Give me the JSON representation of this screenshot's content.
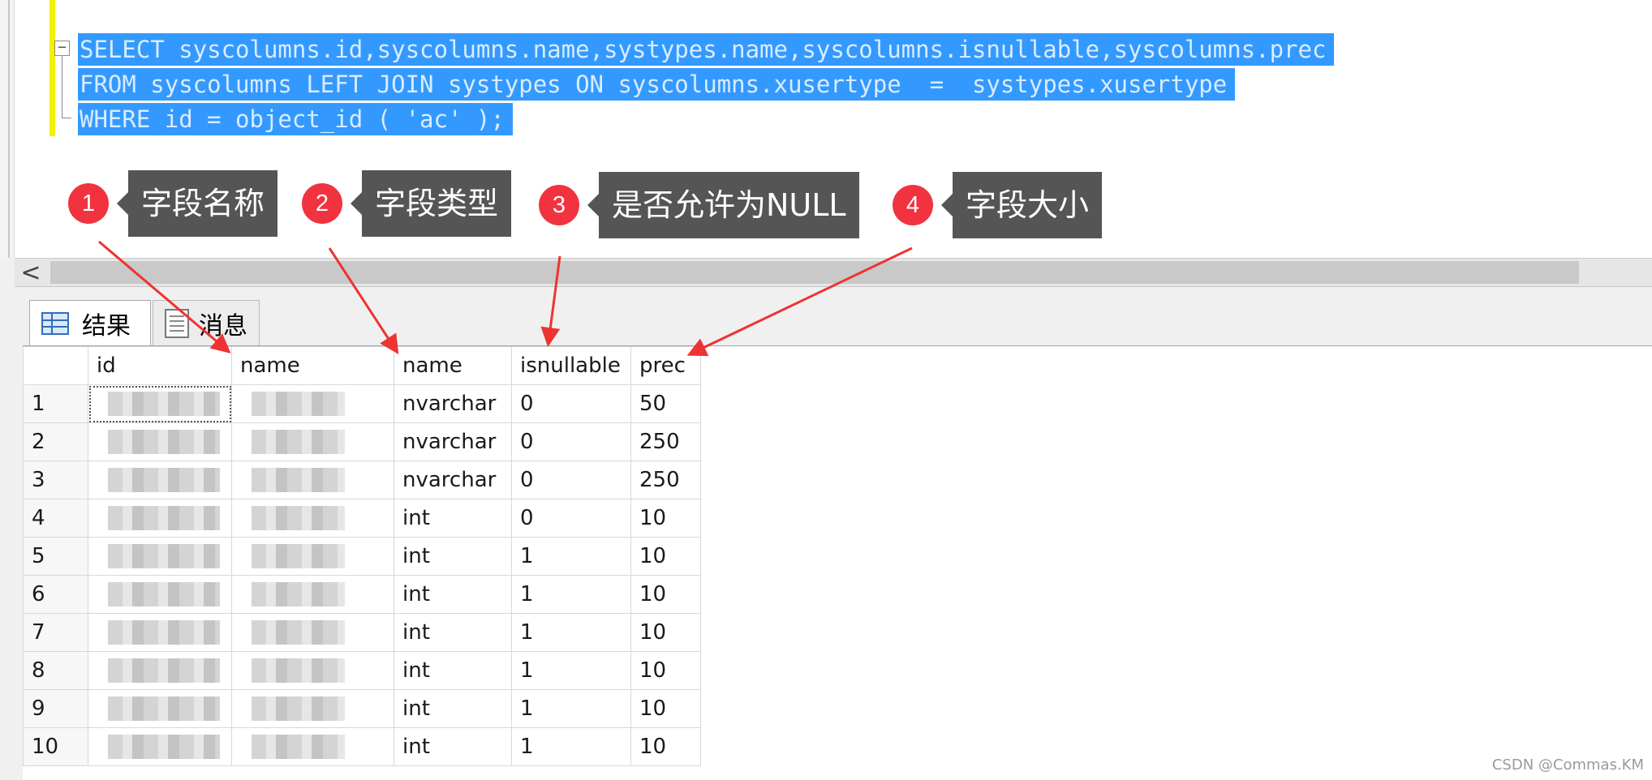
{
  "editor": {
    "sql_lines": [
      "SELECT syscolumns.id,syscolumns.name,systypes.name,syscolumns.isnullable,syscolumns.prec",
      "FROM syscolumns LEFT JOIN systypes ON syscolumns.xusertype  =  systypes.xusertype",
      "WHERE id = object_id ( 'ac' );"
    ],
    "fold_symbol": "−"
  },
  "annotations": [
    {
      "number": "1",
      "label": "字段名称"
    },
    {
      "number": "2",
      "label": "字段类型"
    },
    {
      "number": "3",
      "label": "是否允许为NULL"
    },
    {
      "number": "4",
      "label": "字段大小"
    }
  ],
  "scrollbar": {
    "left_arrow": "<"
  },
  "tabs": {
    "results": {
      "label": "结果",
      "icon": "grid-icon"
    },
    "messages": {
      "label": "消息",
      "icon": "document-icon"
    }
  },
  "grid": {
    "columns": [
      "id",
      "name",
      "name",
      "isnullable",
      "prec"
    ],
    "rows": [
      {
        "num": "1",
        "type": "nvarchar",
        "isnullable": "0",
        "prec": "50"
      },
      {
        "num": "2",
        "type": "nvarchar",
        "isnullable": "0",
        "prec": "250"
      },
      {
        "num": "3",
        "type": "nvarchar",
        "isnullable": "0",
        "prec": "250"
      },
      {
        "num": "4",
        "type": "int",
        "isnullable": "0",
        "prec": "10"
      },
      {
        "num": "5",
        "type": "int",
        "isnullable": "1",
        "prec": "10"
      },
      {
        "num": "6",
        "type": "int",
        "isnullable": "1",
        "prec": "10"
      },
      {
        "num": "7",
        "type": "int",
        "isnullable": "1",
        "prec": "10"
      },
      {
        "num": "8",
        "type": "int",
        "isnullable": "1",
        "prec": "10"
      },
      {
        "num": "9",
        "type": "int",
        "isnullable": "1",
        "prec": "10"
      },
      {
        "num": "10",
        "type": "int",
        "isnullable": "1",
        "prec": "10"
      }
    ]
  },
  "watermark": "CSDN @Commas.KM",
  "colors": {
    "selection": "#3399ff",
    "annotation_red": "#f0333f",
    "tag_bg": "#555555",
    "arrow": "#ee3333"
  }
}
